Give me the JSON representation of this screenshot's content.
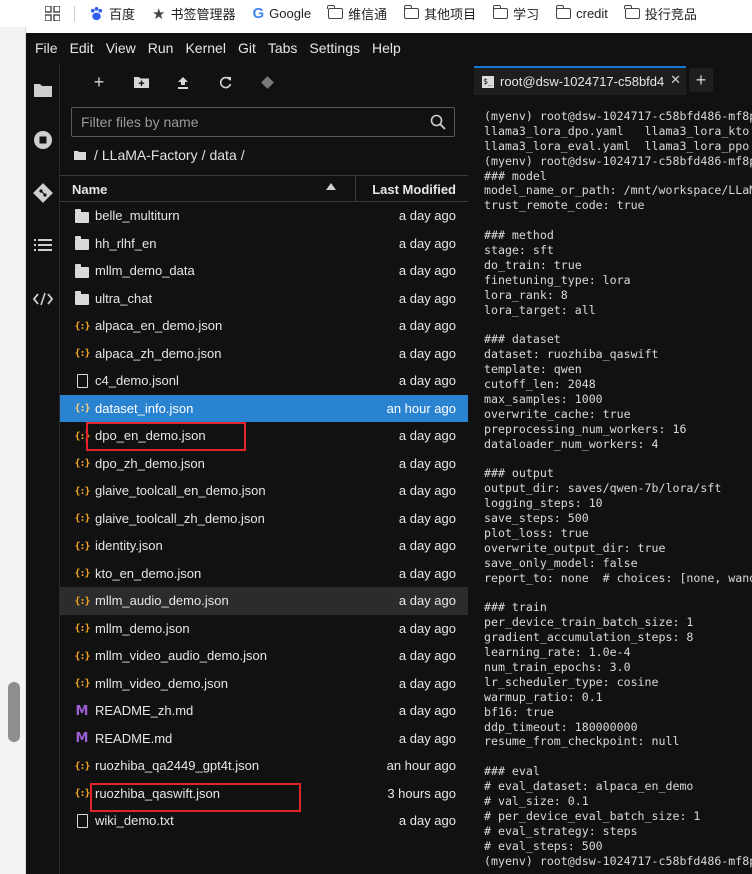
{
  "bookmarks": [
    {
      "label": "",
      "icon": "apps-grid-icon"
    },
    {
      "label": "百度",
      "icon": "baidu-paw-icon"
    },
    {
      "label": "书签管理器",
      "icon": "star-icon"
    },
    {
      "label": "Google",
      "icon": "google-g-icon"
    },
    {
      "label": "维信通",
      "icon": "folder-icon"
    },
    {
      "label": "其他项目",
      "icon": "folder-icon"
    },
    {
      "label": "学习",
      "icon": "folder-icon"
    },
    {
      "label": "credit",
      "icon": "folder-icon"
    },
    {
      "label": "投行竞品",
      "icon": "folder-icon"
    }
  ],
  "menubar": [
    "File",
    "Edit",
    "View",
    "Run",
    "Kernel",
    "Git",
    "Tabs",
    "Settings",
    "Help"
  ],
  "filebrowser": {
    "filter_placeholder": "Filter files by name",
    "breadcrumb": [
      "LLaMA-Factory",
      "data"
    ],
    "columns": {
      "name": "Name",
      "modified": "Last Modified"
    },
    "files": [
      {
        "name": "belle_multiturn",
        "type": "folder",
        "modified": "a day ago"
      },
      {
        "name": "hh_rlhf_en",
        "type": "folder",
        "modified": "a day ago"
      },
      {
        "name": "mllm_demo_data",
        "type": "folder",
        "modified": "a day ago"
      },
      {
        "name": "ultra_chat",
        "type": "folder",
        "modified": "a day ago"
      },
      {
        "name": "alpaca_en_demo.json",
        "type": "json",
        "modified": "a day ago"
      },
      {
        "name": "alpaca_zh_demo.json",
        "type": "json",
        "modified": "a day ago"
      },
      {
        "name": "c4_demo.jsonl",
        "type": "file",
        "modified": "a day ago"
      },
      {
        "name": "dataset_info.json",
        "type": "json",
        "modified": "an hour ago",
        "selected": true
      },
      {
        "name": "dpo_en_demo.json",
        "type": "json",
        "modified": "a day ago"
      },
      {
        "name": "dpo_zh_demo.json",
        "type": "json",
        "modified": "a day ago"
      },
      {
        "name": "glaive_toolcall_en_demo.json",
        "type": "json",
        "modified": "a day ago"
      },
      {
        "name": "glaive_toolcall_zh_demo.json",
        "type": "json",
        "modified": "a day ago"
      },
      {
        "name": "identity.json",
        "type": "json",
        "modified": "a day ago"
      },
      {
        "name": "kto_en_demo.json",
        "type": "json",
        "modified": "a day ago"
      },
      {
        "name": "mllm_audio_demo.json",
        "type": "json",
        "modified": "a day ago",
        "hover": true
      },
      {
        "name": "mllm_demo.json",
        "type": "json",
        "modified": "a day ago"
      },
      {
        "name": "mllm_video_audio_demo.json",
        "type": "json",
        "modified": "a day ago"
      },
      {
        "name": "mllm_video_demo.json",
        "type": "json",
        "modified": "a day ago"
      },
      {
        "name": "README_zh.md",
        "type": "md",
        "modified": "a day ago"
      },
      {
        "name": "README.md",
        "type": "md",
        "modified": "a day ago"
      },
      {
        "name": "ruozhiba_qa2449_gpt4t.json",
        "type": "json",
        "modified": "an hour ago"
      },
      {
        "name": "ruozhiba_qaswift.json",
        "type": "json",
        "modified": "3 hours ago"
      },
      {
        "name": "wiki_demo.txt",
        "type": "file",
        "modified": "a day ago"
      }
    ]
  },
  "terminal": {
    "tab_title": "root@dsw-1024717-c58bfd4",
    "lines": [
      "(myenv) root@dsw-1024717-c58bfd486-mf8p",
      "llama3_lora_dpo.yaml   llama3_lora_kto.",
      "llama3_lora_eval.yaml  llama3_lora_ppo.",
      "(myenv) root@dsw-1024717-c58bfd486-mf8p",
      "### model",
      "model_name_or_path: /mnt/workspace/LLaM",
      "trust_remote_code: true",
      "",
      "### method",
      "stage: sft",
      "do_train: true",
      "finetuning_type: lora",
      "lora_rank: 8",
      "lora_target: all",
      "",
      "### dataset",
      "dataset: ruozhiba_qaswift",
      "template: qwen",
      "cutoff_len: 2048",
      "max_samples: 1000",
      "overwrite_cache: true",
      "preprocessing_num_workers: 16",
      "dataloader_num_workers: 4",
      "",
      "### output",
      "output_dir: saves/qwen-7b/lora/sft",
      "logging_steps: 10",
      "save_steps: 500",
      "plot_loss: true",
      "overwrite_output_dir: true",
      "save_only_model: false",
      "report_to: none  # choices: [none, wand",
      "",
      "### train",
      "per_device_train_batch_size: 1",
      "gradient_accumulation_steps: 8",
      "learning_rate: 1.0e-4",
      "num_train_epochs: 3.0",
      "lr_scheduler_type: cosine",
      "warmup_ratio: 0.1",
      "bf16: true",
      "ddp_timeout: 180000000",
      "resume_from_checkpoint: null",
      "",
      "### eval",
      "# eval_dataset: alpaca_en_demo",
      "# val_size: 0.1",
      "# per_device_eval_batch_size: 1",
      "# eval_strategy: steps",
      "# eval_steps: 500",
      "(myenv) root@dsw-1024717-c58bfd486-mf8p"
    ]
  },
  "colors": {
    "selection": "#2a83d0",
    "annotation_box": "#e0242a",
    "json_icon": "#f5a623",
    "md_icon": "#9c5fd6"
  }
}
